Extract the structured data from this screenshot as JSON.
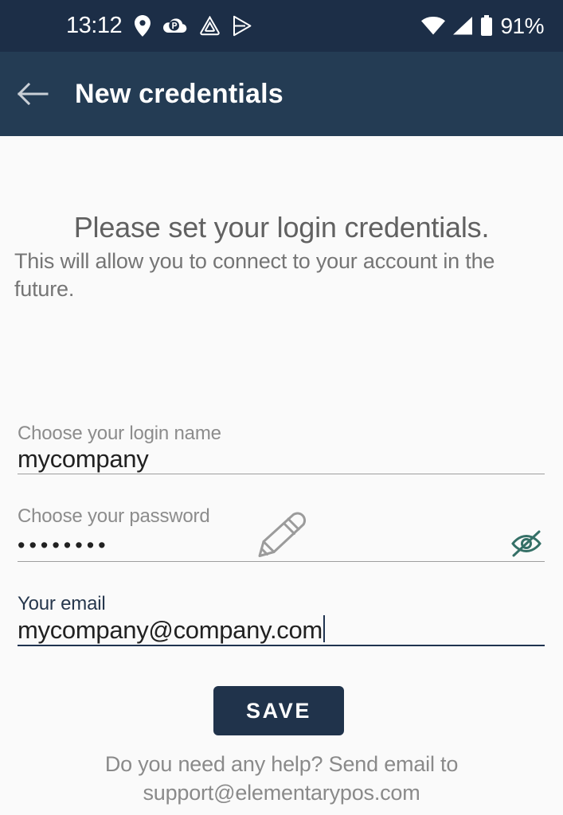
{
  "status_bar": {
    "time": "13:12",
    "battery_percent": "91%",
    "icons": [
      "location-pin-icon",
      "parking-cloud-icon",
      "drive-triangle-icon",
      "play-store-icon"
    ],
    "right_icons": [
      "wifi-icon",
      "cellular-signal-icon",
      "battery-icon"
    ],
    "background_color": "#1c2e47"
  },
  "app_bar": {
    "title": "New credentials",
    "back_icon": "arrow-left-icon",
    "background_color": "#243c54"
  },
  "content": {
    "headline": "Please set your login credentials.",
    "subhead": "This will allow you to connect to your account in the future.",
    "decor_icon": "pencil-icon"
  },
  "form": {
    "login": {
      "label": "Choose your login name",
      "value": "mycompany",
      "placeholder": "Choose your login name",
      "focused": false
    },
    "password": {
      "label": "Choose your password",
      "value": "••••••••",
      "placeholder": "Choose your password",
      "focused": false,
      "toggle_icon": "eye-off-icon",
      "toggle_color": "#357067"
    },
    "email": {
      "label": "Your email",
      "value": "mycompany@company.com",
      "placeholder": "Your email",
      "focused": true
    }
  },
  "actions": {
    "save_label": "SAVE",
    "save_color": "#20334b"
  },
  "footer": {
    "support_text": "Do you need any help? Send email to support@elementarypos.com"
  }
}
